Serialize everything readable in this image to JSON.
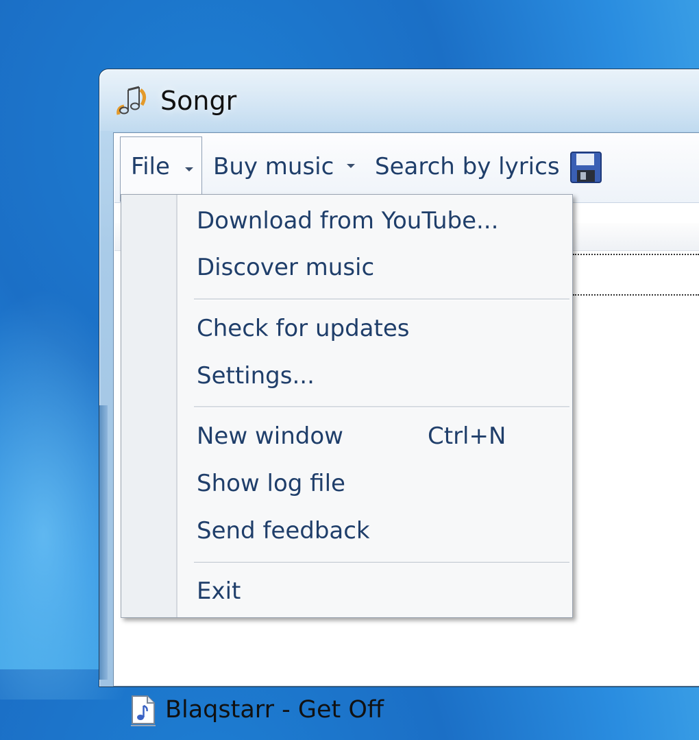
{
  "window": {
    "title": "Songr"
  },
  "toolbar": {
    "file_label": "File",
    "buy_music_label": "Buy music",
    "search_lyrics_label": "Search by lyrics"
  },
  "file_menu": {
    "items": [
      {
        "label": "Download from YouTube..."
      },
      {
        "label": "Discover music"
      },
      {
        "label": "Check for updates"
      },
      {
        "label": "Settings..."
      },
      {
        "label": "New window",
        "shortcut": "Ctrl+N"
      },
      {
        "label": "Show log file"
      },
      {
        "label": "Send feedback"
      },
      {
        "label": "Exit"
      }
    ]
  },
  "song_list": {
    "items": [
      {
        "label": "Blaqstarr - Get Off"
      }
    ]
  },
  "icons": {
    "app": "music-note-icon",
    "save": "floppy-disk-icon",
    "song": "music-file-icon"
  }
}
